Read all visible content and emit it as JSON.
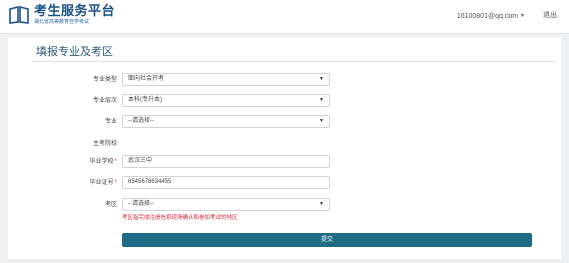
{
  "header": {
    "title": "考生服务平台",
    "subtitle": "湖北省高等教育自学考试",
    "user_email": "16100801@qq.com",
    "logout": "退出"
  },
  "form": {
    "title": "填报专业及考区",
    "major_type": {
      "label": "专业类型",
      "value": "面向社会开考"
    },
    "major_level": {
      "label": "专业层次",
      "value": "本科(专升本)"
    },
    "major": {
      "label": "专业",
      "value": "--请选择--"
    },
    "school_section": {
      "label": "主考院校"
    },
    "graduate_school": {
      "label": "毕业学校",
      "required_mark": "*",
      "value": "武汉三中"
    },
    "certificate_no": {
      "label": "毕业证号",
      "required_mark": "*",
      "value": "6545678634455"
    },
    "exam_area": {
      "label": "考区",
      "value": "--请选择--"
    },
    "exam_area_hint": "考区指完成注册信息现场确认和参加考试的地区",
    "submit_label": "提交"
  },
  "colors": {
    "brand": "#1a4f8a",
    "submit_bg": "#1f6b85",
    "required": "#e0262f",
    "hint": "#d9232d"
  },
  "icons": {
    "logo": "book-icon",
    "dropdown": "chevron-down-icon"
  }
}
